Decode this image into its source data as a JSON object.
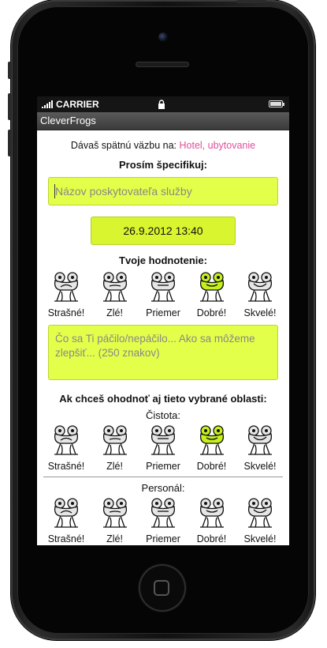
{
  "status": {
    "carrier": "CARRIER"
  },
  "app": {
    "title": "CleverFrogs"
  },
  "feedback": {
    "prefix": "Dávaš spätnú väzbu na:",
    "category": "Hotel, ubytovanie"
  },
  "specify_heading": "Prosím špecifikuj:",
  "provider_input": {
    "placeholder": "Názov poskytovateľa služby",
    "value": ""
  },
  "date_time": "26.9.2012 13:40",
  "rating_heading": "Tvoje hodnotenie:",
  "rating_options": [
    "Strašné!",
    "Zlé!",
    "Priemer",
    "Dobré!",
    "Skvelé!"
  ],
  "main_rating_selected": "Dobré!",
  "comment": {
    "placeholder": "Čo sa Ti páčilo/nepáčilo... Ako sa môžeme zlepšiť... (250 znakov)"
  },
  "areas_heading": "Ak chceš ohodnoť aj tieto vybrané oblasti:",
  "areas": [
    {
      "label": "Čistota:",
      "selected": "Dobré!"
    },
    {
      "label": "Personál:",
      "selected": ""
    }
  ],
  "colors": {
    "accent": "#e4ff4a",
    "category": "#e04e9a",
    "selected_frog": "#c6ef1e"
  }
}
